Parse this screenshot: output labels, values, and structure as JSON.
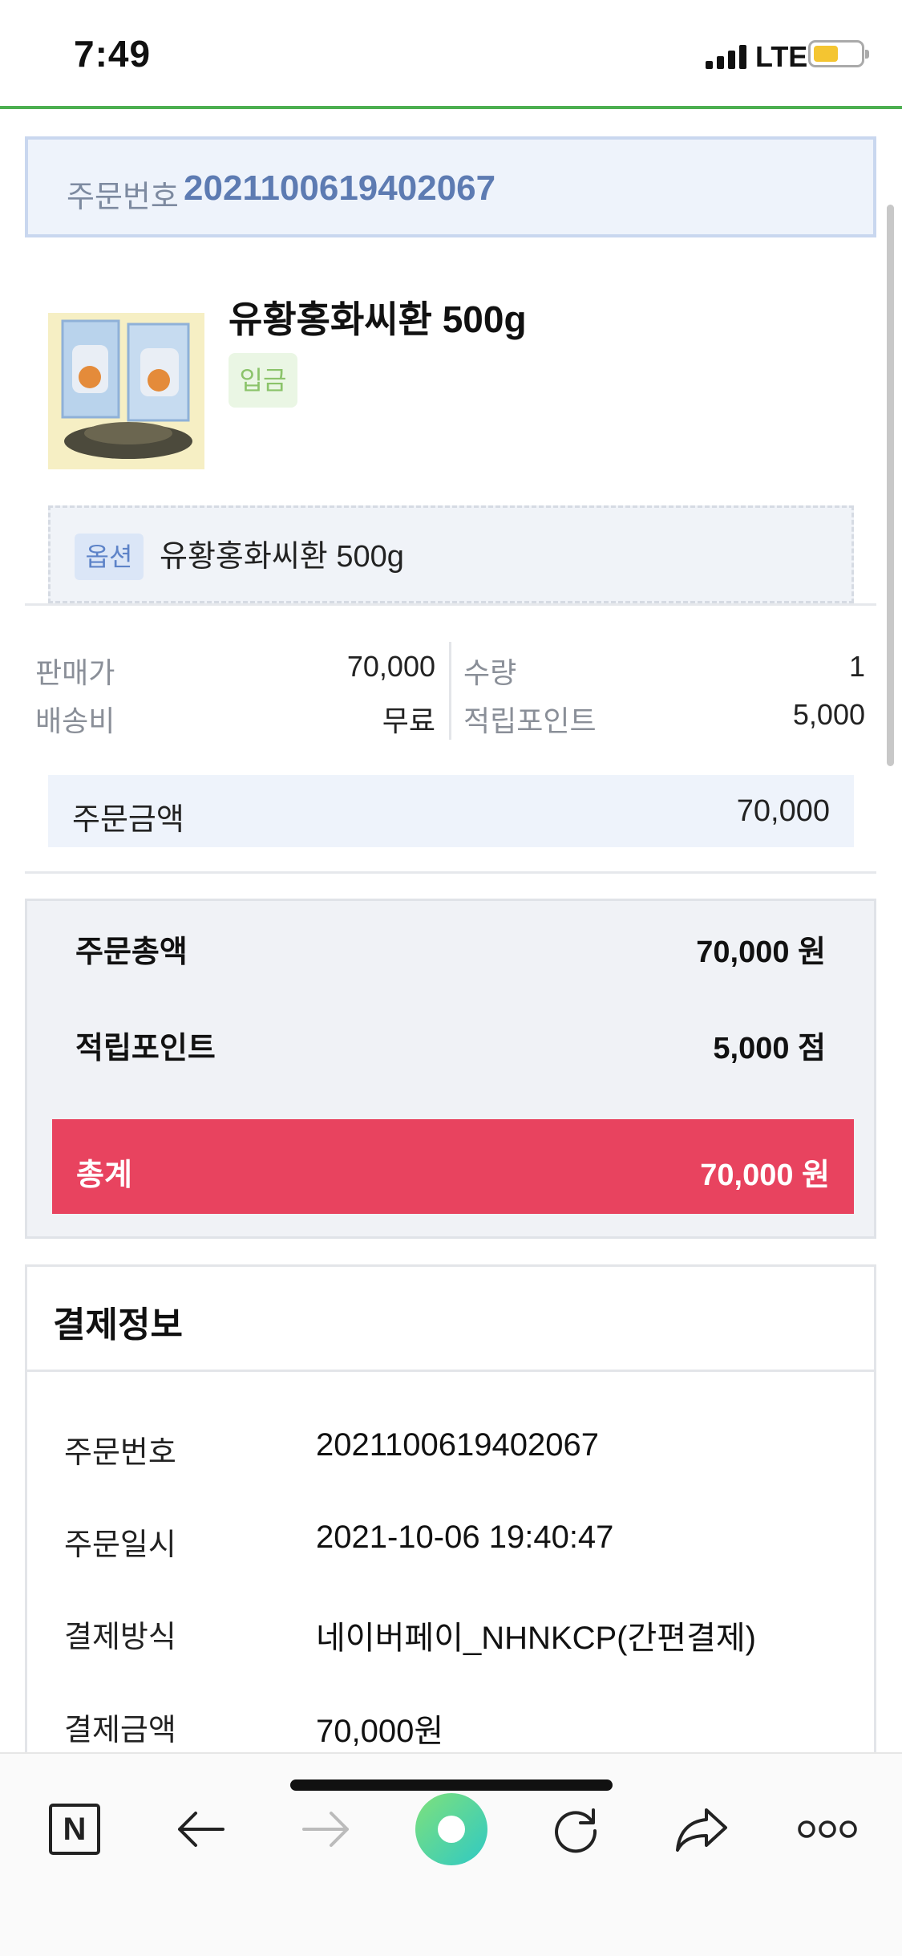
{
  "status_bar": {
    "time": "7:49",
    "network": "LTE"
  },
  "order_header": {
    "label": "주문번호",
    "number": "2021100619402067"
  },
  "product": {
    "name": "유황홍화씨환 500g",
    "status_badge": "입금",
    "option_tag": "옵션",
    "option_text": "유황홍화씨환 500g"
  },
  "details": {
    "price_label": "판매가",
    "price_value": "70,000",
    "qty_label": "수량",
    "qty_value": "1",
    "shipping_label": "배송비",
    "shipping_value": "무료",
    "points_label": "적립포인트",
    "points_value": "5,000"
  },
  "order_amount": {
    "label": "주문금액",
    "value": "70,000"
  },
  "summary": {
    "total_label": "주문총액",
    "total_value": "70,000 원",
    "points_label": "적립포인트",
    "points_value": "5,000 점",
    "grand_label": "총계",
    "grand_value": "70,000 원",
    "grand_color": "#e8435f"
  },
  "payment_info": {
    "title": "결제정보",
    "rows": [
      {
        "key": "주문번호",
        "value": "2021100619402067"
      },
      {
        "key": "주문일시",
        "value": "2021-10-06 19:40:47"
      },
      {
        "key": "결제방식",
        "value": "네이버페이_NHNKCP(간편결제)"
      },
      {
        "key": "결제금액",
        "value": "70,000원"
      }
    ]
  },
  "toolbar": {
    "home_label": "N",
    "icons": [
      "naver-home-icon",
      "back-arrow-icon",
      "forward-arrow-icon",
      "green-menu-icon",
      "refresh-icon",
      "share-icon",
      "more-icon"
    ]
  },
  "colors": {
    "accent_green": "#4caf50",
    "order_blue": "#5d7bb2",
    "total_red": "#e8435f"
  }
}
